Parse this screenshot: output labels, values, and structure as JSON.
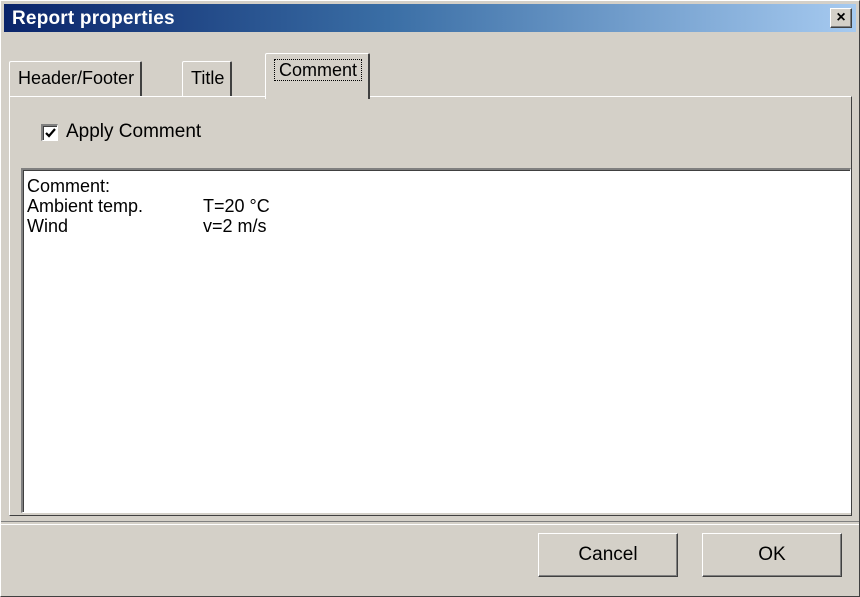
{
  "window": {
    "title": "Report properties",
    "close_glyph": "×"
  },
  "tabs": [
    {
      "label": "Header/Footer",
      "active": false
    },
    {
      "label": "Title",
      "active": false
    },
    {
      "label": "Comment",
      "active": true
    }
  ],
  "apply_comment": {
    "label": "Apply Comment",
    "checked": true
  },
  "comment_text": {
    "lines": [
      {
        "c1": "Comment:",
        "c2": ""
      },
      {
        "c1": "Ambient temp.",
        "c2": "T=20 °C"
      },
      {
        "c1": "Wind",
        "c2": "v=2 m/s"
      }
    ]
  },
  "buttons": {
    "cancel": "Cancel",
    "ok": "OK"
  },
  "colors": {
    "title_gradient_start": "#0a246a",
    "title_gradient_end": "#a6caf0",
    "face": "#d4d0c8"
  },
  "icons": {
    "close": "close-icon",
    "check": "checkmark-icon"
  }
}
